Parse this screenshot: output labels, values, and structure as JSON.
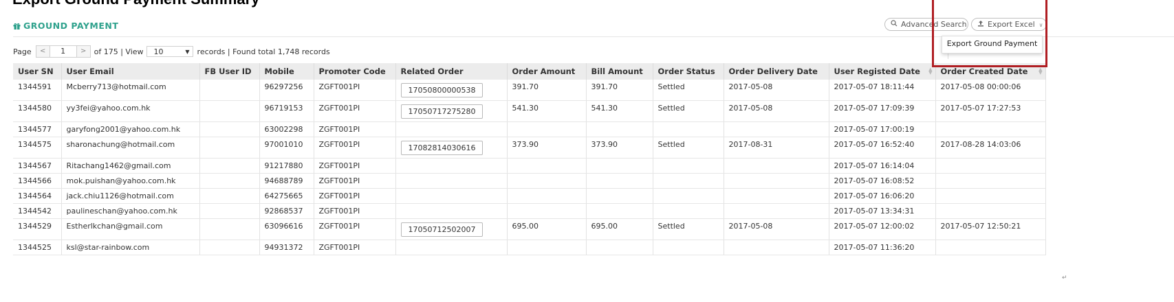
{
  "header": {
    "title": "GROUND PAYMENT",
    "advanced_search": "Advanced Search",
    "export_excel": "Export Excel",
    "dropdown_item": "Export Ground Payment",
    "user_email_placeholder": "User Email"
  },
  "pager": {
    "page_label": "Page",
    "prev": "<",
    "current": "1",
    "next": ">",
    "of_text": "of 175 | View",
    "view": "10",
    "records_text": "records | Found total 1,748 records"
  },
  "table": {
    "columns": [
      "User SN",
      "User Email",
      "FB User ID",
      "Mobile",
      "Promoter Code",
      "Related Order",
      "Order Amount",
      "Bill Amount",
      "Order Status",
      "Order Delivery Date",
      "User Registed Date",
      "Order Created Date"
    ],
    "rows": [
      [
        "1344591",
        "Mcberry713@hotmail.com",
        "",
        "96297256",
        "ZGFT001PI",
        "17050800000538",
        "391.70",
        "391.70",
        "Settled",
        "2017-05-08",
        "2017-05-07 18:11:44",
        "2017-05-08 00:00:06"
      ],
      [
        "1344580",
        "yy3fei@yahoo.com.hk",
        "",
        "96719153",
        "ZGFT001PI",
        "17050717275280",
        "541.30",
        "541.30",
        "Settled",
        "2017-05-08",
        "2017-05-07 17:09:39",
        "2017-05-07 17:27:53"
      ],
      [
        "1344577",
        "garyfong2001@yahoo.com.hk",
        "",
        "63002298",
        "ZGFT001PI",
        "",
        "",
        "",
        "",
        "",
        "2017-05-07 17:00:19",
        ""
      ],
      [
        "1344575",
        "sharonachung@hotmail.com",
        "",
        "97001010",
        "ZGFT001PI",
        "17082814030616",
        "373.90",
        "373.90",
        "Settled",
        "2017-08-31",
        "2017-05-07 16:52:40",
        "2017-08-28 14:03:06"
      ],
      [
        "1344567",
        "Ritachang1462@gmail.com",
        "",
        "91217880",
        "ZGFT001PI",
        "",
        "",
        "",
        "",
        "",
        "2017-05-07 16:14:04",
        ""
      ],
      [
        "1344566",
        "mok.puishan@yahoo.com.hk",
        "",
        "94688789",
        "ZGFT001PI",
        "",
        "",
        "",
        "",
        "",
        "2017-05-07 16:08:52",
        ""
      ],
      [
        "1344564",
        "jack.chiu1126@hotmail.com",
        "",
        "64275665",
        "ZGFT001PI",
        "",
        "",
        "",
        "",
        "",
        "2017-05-07 16:06:20",
        ""
      ],
      [
        "1344542",
        "paulineschan@yahoo.com.hk",
        "",
        "92868537",
        "ZGFT001PI",
        "",
        "",
        "",
        "",
        "",
        "2017-05-07 13:34:31",
        ""
      ],
      [
        "1344529",
        "Estherlkchan@gmail.com",
        "",
        "63096616",
        "ZGFT001PI",
        "17050712502007",
        "695.00",
        "695.00",
        "Settled",
        "2017-05-08",
        "2017-05-07 12:00:02",
        "2017-05-07 12:50:21"
      ],
      [
        "1344525",
        "ksl@star-rainbow.com",
        "",
        "94931372",
        "ZGFT001PI",
        "",
        "",
        "",
        "",
        "",
        "2017-05-07 11:36:20",
        ""
      ]
    ]
  },
  "colors": {
    "accent": "#2ea18c",
    "highlight": "#b01e23"
  }
}
